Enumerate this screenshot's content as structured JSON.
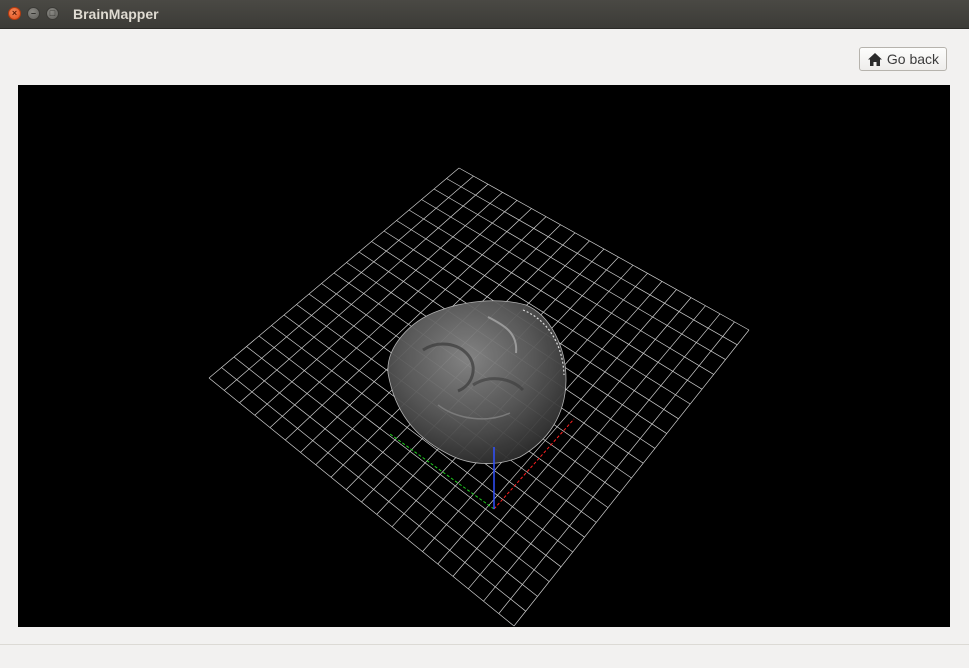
{
  "window": {
    "title": "BrainMapper",
    "controls": [
      "close-icon",
      "minimize-icon",
      "maximize-icon"
    ]
  },
  "toolbar": {
    "go_back_label": "Go back",
    "go_back_icon": "home-icon"
  },
  "viewer": {
    "background": "#000000",
    "grid_color": "#cfcfcf",
    "axis_colors": {
      "x": "#ff2020",
      "y": "#20d020",
      "z": "#3050ff"
    },
    "content": "3D rendered brain volume on grid"
  }
}
